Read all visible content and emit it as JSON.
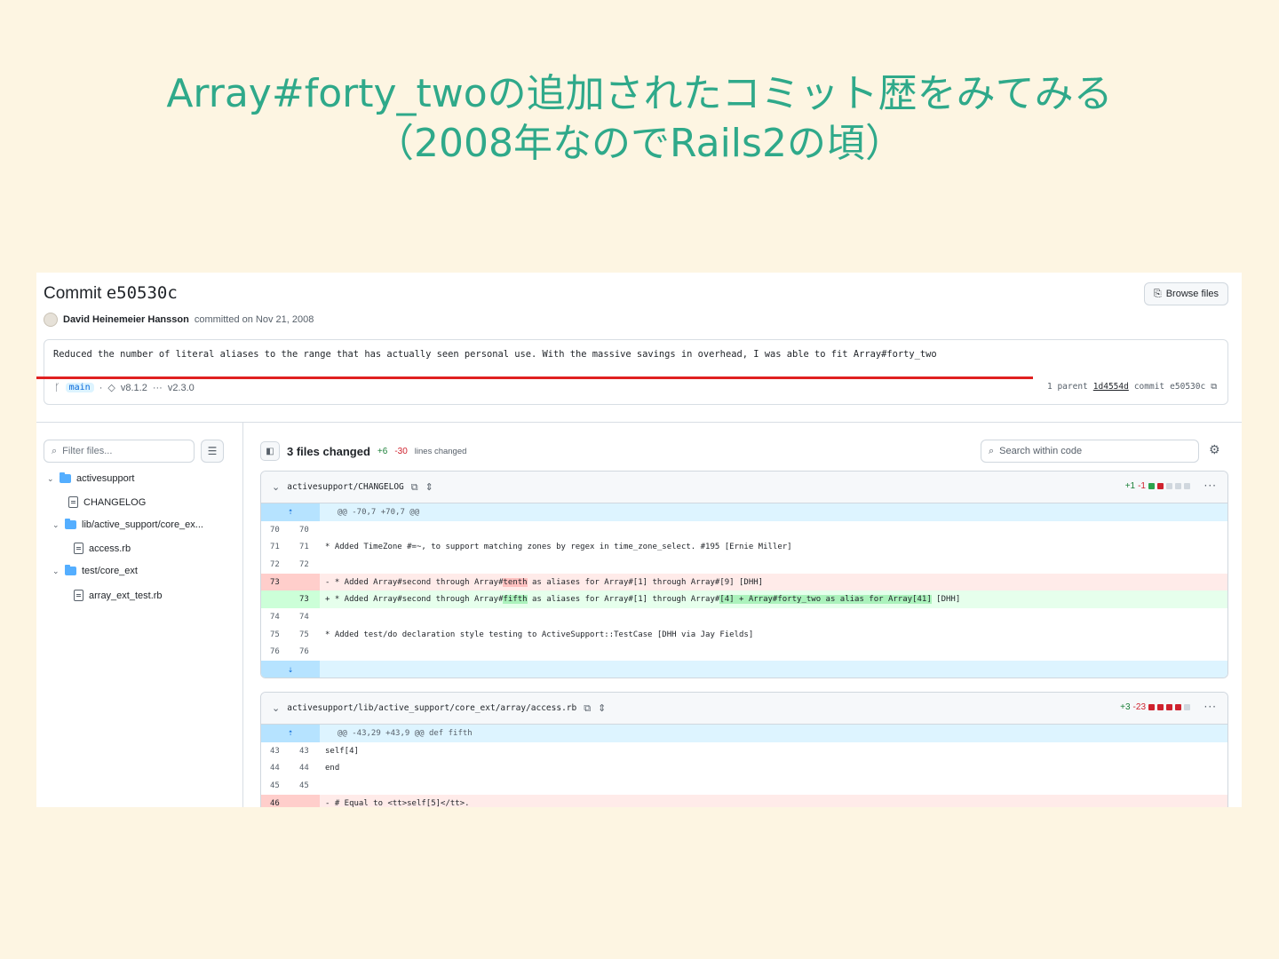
{
  "slide": {
    "title_line1": "Array#forty_twoの追加されたコミット歴をみてみる",
    "title_line2": "（2008年なのでRails2の頃）"
  },
  "commit": {
    "label": "Commit",
    "sha": "e50530c",
    "browse_files": "Browse files",
    "author": "David Heinemeier Hansson",
    "committed_on": "committed on Nov 21, 2008",
    "message": "Reduced the number of literal aliases to the range that has actually seen personal use. With the massive savings in overhead, I was able to fit Array#forty_two",
    "branch": "main",
    "tag_from": "v8.1.2",
    "tag_ellipsis": "···",
    "tag_to": "v2.3.0",
    "parent_label": "1 parent",
    "parent_sha": "1d4554d",
    "commit_label": "commit",
    "commit_full": "e50530c"
  },
  "sidebar": {
    "filter_placeholder": "Filter files...",
    "tree": [
      {
        "label": "activesupport"
      },
      {
        "label": "CHANGELOG"
      },
      {
        "label": "lib/active_support/core_ex..."
      },
      {
        "label": "access.rb"
      },
      {
        "label": "test/core_ext"
      },
      {
        "label": "array_ext_test.rb"
      }
    ]
  },
  "diffs": {
    "files_changed": "3 files changed",
    "additions": "+6",
    "deletions": "-30",
    "lines_changed": "lines changed",
    "search_placeholder": "Search within code",
    "file1": {
      "path": "activesupport/CHANGELOG",
      "stat_add": "+1",
      "stat_del": "-1",
      "hunk": "@@ -70,7 +70,7 @@",
      "rows": [
        {
          "l": "70",
          "r": "70",
          "code": ""
        },
        {
          "l": "71",
          "r": "71",
          "code": "  * Added TimeZone #=~, to support matching zones by regex in time_zone_select. #195 [Ernie Miller]"
        },
        {
          "l": "72",
          "r": "72",
          "code": ""
        }
      ],
      "del_ln": "73",
      "del_a": "- * Added Array#second through Array#",
      "del_b": "tenth",
      "del_c": " as aliases for Array#[1] through Array#[9] [DHH]",
      "add_ln": "73",
      "add_a": "+ * Added Array#second through Array#",
      "add_b": "fifth",
      "add_c": " as aliases for Array#[1] through Array#",
      "add_d": "[4] + Array#forty_two as alias for Array[41]",
      "add_e": " [DHH]",
      "rows2": [
        {
          "l": "74",
          "r": "74",
          "code": ""
        },
        {
          "l": "75",
          "r": "75",
          "code": "  * Added test/do declaration style testing to ActiveSupport::TestCase [DHH via Jay Fields]"
        },
        {
          "l": "76",
          "r": "76",
          "code": ""
        }
      ]
    },
    "file2": {
      "path": "activesupport/lib/active_support/core_ext/array/access.rb",
      "stat_add": "+3",
      "stat_del": "-23",
      "hunk": "@@ -43,29 +43,9 @@ def fifth",
      "rows": [
        {
          "l": "43",
          "r": "43",
          "code": "          self[4]"
        },
        {
          "l": "44",
          "r": "44",
          "code": "        end"
        },
        {
          "l": "45",
          "r": "45",
          "code": ""
        }
      ],
      "del_ln": "46",
      "del_code": "-        # Equal to <tt>self[5]</tt>."
    }
  }
}
